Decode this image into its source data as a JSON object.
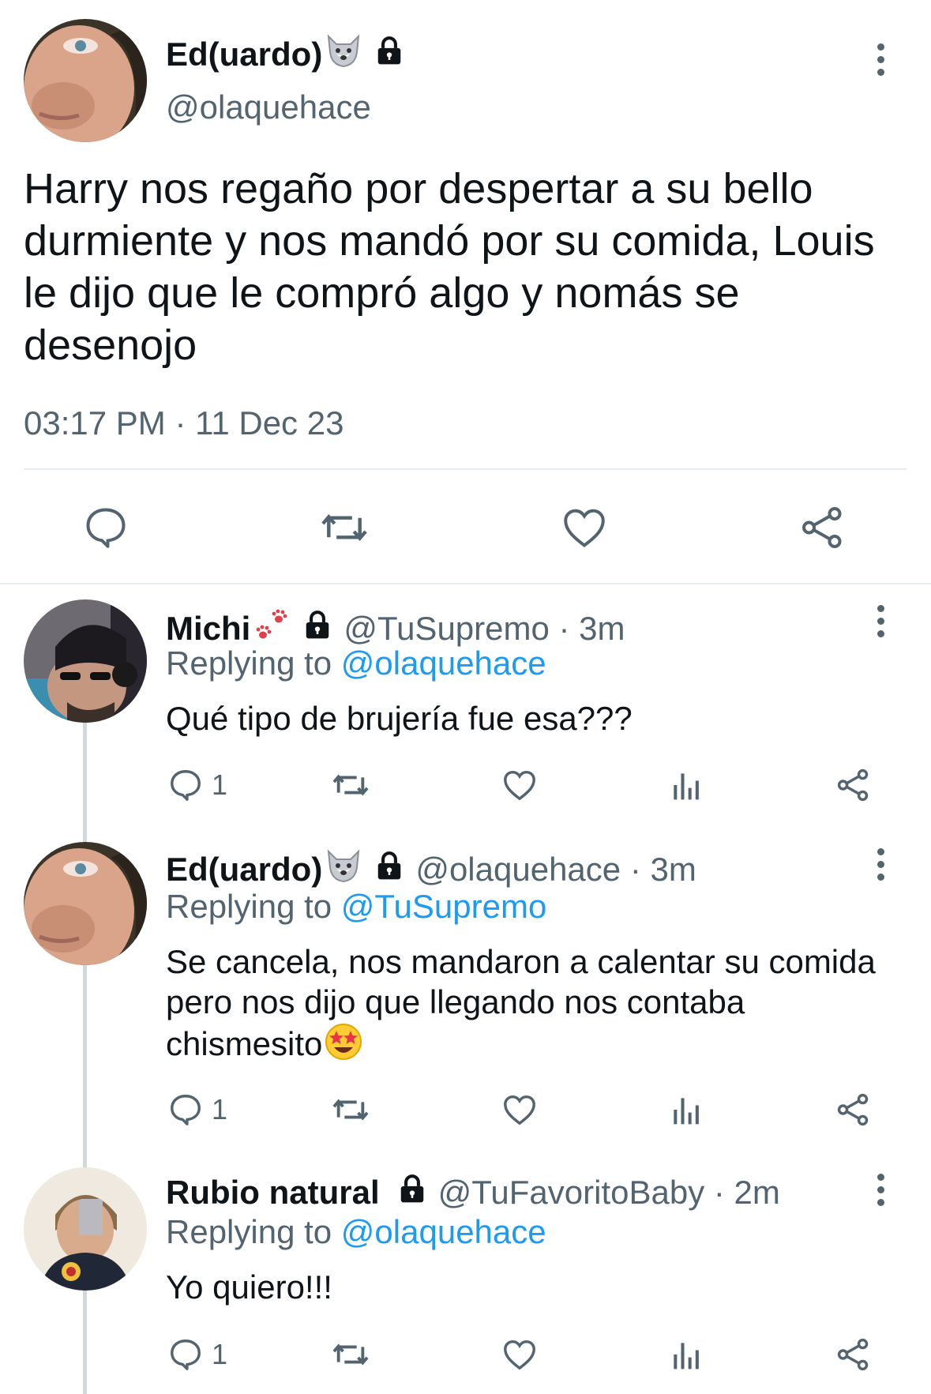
{
  "main_tweet": {
    "display_name": "Ed(uardo)",
    "handle": "@olaquehace",
    "text": "Harry nos regaño por despertar a su bello durmiente y nos mandó por su comida, Louis le dijo que le compró algo y nomás se desenojo",
    "timestamp": "03:17 PM · 11 Dec 23"
  },
  "replies": [
    {
      "display_name": "Michi",
      "handle_time": "@TuSupremo · 3m",
      "replying_prefix": "Replying to ",
      "replying_to": "@olaquehace",
      "text": "Qué tipo de brujería fue esa???",
      "reply_count": "1"
    },
    {
      "display_name": "Ed(uardo)",
      "handle_time": "@olaquehace · 3m",
      "replying_prefix": "Replying to ",
      "replying_to": "@TuSupremo",
      "text": "Se cancela, nos mandaron a calentar su comida pero nos dijo que llegando nos contaba chismesito",
      "reply_count": "1"
    },
    {
      "display_name": "Rubio natural",
      "handle_time": "@TuFavoritoBaby · 2m",
      "replying_prefix": "Replying to ",
      "replying_to": "@olaquehace",
      "text": "Yo quiero!!!",
      "reply_count": "1"
    }
  ],
  "icons": {
    "reply": "speech-bubble-icon",
    "retweet": "retweet-icon",
    "like": "heart-icon",
    "analytics": "bar-chart-icon",
    "share": "share-icon",
    "more": "more-vertical-icon",
    "lock": "lock-icon",
    "wolf": "wolf-face-emoji",
    "paws": "paw-prints-emoji",
    "star_eyes": "star-struck-emoji"
  },
  "colors": {
    "text": "#0f1419",
    "secondary": "#536471",
    "link": "#1d9bf0",
    "divider": "#e6ecf0"
  }
}
